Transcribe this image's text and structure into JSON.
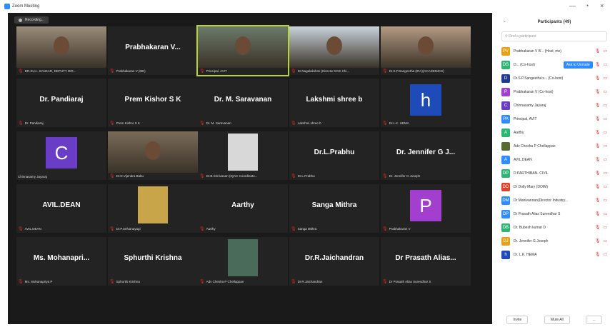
{
  "window": {
    "title": "Zoom Meeting",
    "minimize": "—",
    "restore": "◔",
    "close": "×"
  },
  "recording": {
    "label": "Recording..."
  },
  "tiles": [
    {
      "big": "",
      "cap": "DR.SUJ...SANKAR, DEPUTY DIR..."
    },
    {
      "big": "Prabhakaran V...",
      "cap": "Prabhakaran V (ME)"
    },
    {
      "big": "",
      "cap": "Principal, AVIT"
    },
    {
      "big": "",
      "cap": "Dr.Nagalakshmi (Director ECE Chi..."
    },
    {
      "big": "",
      "cap": "Dr.S.P.Sangeetha (IRA)(ACADEMICS)"
    },
    {
      "big": "Dr. Pandiaraj",
      "cap": "Dr. Pandiaraj"
    },
    {
      "big": "Prem Kishor S K",
      "cap": "Prem Kishor S K"
    },
    {
      "big": "Dr. M. Saravanan",
      "cap": "Dr. M. Saravanan"
    },
    {
      "big": "Lakshmi shree b",
      "cap": "Lakshmi shree b"
    },
    {
      "big": "",
      "cap": "Dr.L.K. HEMA",
      "avatar": "h",
      "color": "#1f4bb8"
    },
    {
      "big": "",
      "cap": "Chinnasamy Jayaraj",
      "avatar": "C",
      "color": "#6a3dc7"
    },
    {
      "big": "",
      "cap": "Dr.D.Vijendra Babu"
    },
    {
      "big": "",
      "cap": "Dr.B.Srinivasan (IQAC Coordinato..."
    },
    {
      "big": "Dr.L.Prabhu",
      "cap": "Dr.L.Prabhu"
    },
    {
      "big": "Dr. Jennifer G J...",
      "cap": "Dr. Jennifer G Joseph"
    },
    {
      "big": "AVIL.DEAN",
      "cap": "AVIL.DEAN"
    },
    {
      "big": "",
      "cap": "Dr.P.Selvanayagi"
    },
    {
      "big": "Aarthy",
      "cap": "Aarthy"
    },
    {
      "big": "Sanga Mithra",
      "cap": "Sanga Mithra"
    },
    {
      "big": "",
      "cap": "Prabhakaran V",
      "avatar": "P",
      "color": "#a23fcf"
    },
    {
      "big": "Ms. Mohanapri...",
      "cap": "Ms. Mohanapriya P"
    },
    {
      "big": "Sphurthi Krishna",
      "cap": "Sphurthi Krishna"
    },
    {
      "big": "",
      "cap": "Adv Chesha P Chellappan"
    },
    {
      "big": "Dr.R.Jaichandran",
      "cap": "Dr.R.Jaichandran"
    },
    {
      "big": "Dr Prasath Alias...",
      "cap": "Dr Prasath Alias Surendhar S"
    }
  ],
  "participants": {
    "title": "Participants (49)",
    "search_placeholder": "Find a participant",
    "unmute_label": "Ask to Unmute",
    "invite": "Invite",
    "mute_all": "Mute All",
    "more": "...",
    "list": [
      {
        "initials": "PV",
        "color": "#e6a117",
        "name": "Prabhakaran V B...   (Host, me)"
      },
      {
        "initials": "DS",
        "color": "#2bb673",
        "name": "D...  (Co-host)"
      },
      {
        "initials": "D",
        "color": "#1f3b8f",
        "name": "Dr.S.P.Sangeetha's...  (Co-host)"
      },
      {
        "initials": "P",
        "color": "#a23fcf",
        "name": "Prabhakaran V (Co-host)"
      },
      {
        "initials": "C",
        "color": "#6a3dc7",
        "name": "Chinnasamy Jayaraj"
      },
      {
        "initials": "PA",
        "color": "#2d8cff",
        "name": "Principal, AVIT"
      },
      {
        "initials": "A",
        "color": "#2bb673",
        "name": "Aarthy"
      },
      {
        "initials": "",
        "color": "#556b2f",
        "name": "Adv Chesha P Chellappan"
      },
      {
        "initials": "A",
        "color": "#2d8cff",
        "name": "AVIL.DEAN"
      },
      {
        "initials": "DP",
        "color": "#2bb673",
        "name": "D PARTHIBAN- CIVIL"
      },
      {
        "initials": "DD",
        "color": "#e0402b",
        "name": "Dr Dolly Mary (DOIM)"
      },
      {
        "initials": "DM",
        "color": "#2d8cff",
        "name": "Dr Manivannan(Director Industry..."
      },
      {
        "initials": "DP",
        "color": "#2d8cff",
        "name": "Dr Prasath Alias Surendhar S"
      },
      {
        "initials": "DB",
        "color": "#2bb673",
        "name": "Dr. Bubesh kumar D"
      },
      {
        "initials": "DJ",
        "color": "#e6a117",
        "name": "Dr. Jennifer G Joseph"
      },
      {
        "initials": "h",
        "color": "#1f4bb8",
        "name": "Dr. L.K. HEMA"
      }
    ]
  }
}
